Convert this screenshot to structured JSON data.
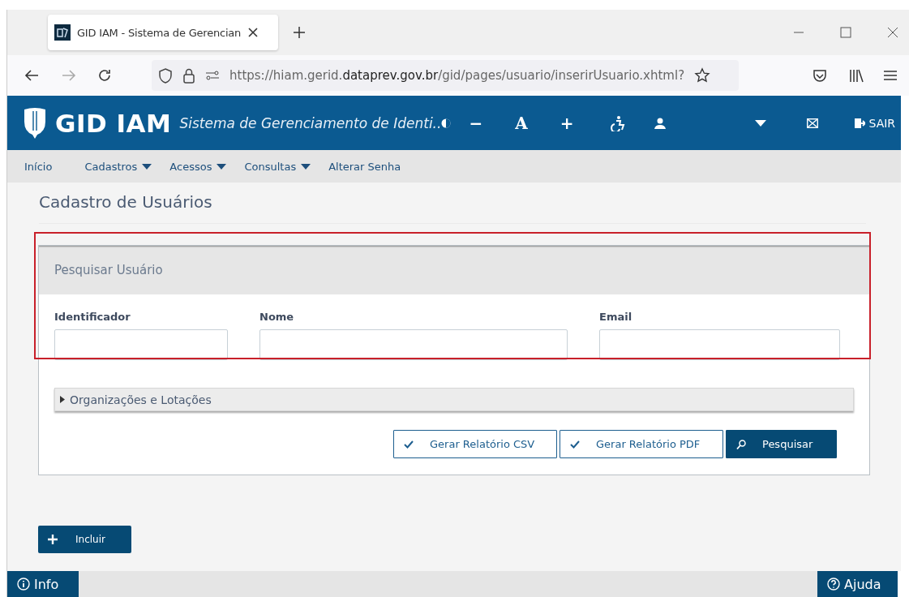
{
  "browser": {
    "tab_title": "GID IAM - Sistema de Gerencian",
    "url": {
      "scheme_host": "https://hiam.gerid.",
      "domain": "dataprev.gov.br",
      "path": "/gid/pages/usuario/inserirUsuario.xhtml?"
    }
  },
  "header": {
    "logo": "GID IAM",
    "subtitle": "Sistema de Gerenciamento de Identi..",
    "tools": [
      "−",
      "A",
      "+"
    ],
    "logout": "SAIR"
  },
  "menu": [
    {
      "label": "Início",
      "dropdown": false
    },
    {
      "label": "Cadastros",
      "dropdown": true
    },
    {
      "label": "Acessos",
      "dropdown": true
    },
    {
      "label": "Consultas",
      "dropdown": true
    },
    {
      "label": "Alterar Senha",
      "dropdown": false
    }
  ],
  "page_title": "Cadastro de Usuários",
  "search_panel": {
    "title": "Pesquisar Usuário",
    "highlighted": true,
    "fields": [
      {
        "label": "Identificador"
      },
      {
        "label": "Nome"
      },
      {
        "label": "Email"
      }
    ]
  },
  "accordion": {
    "label": "Organizações e Lotações",
    "expanded": false
  },
  "actions": [
    {
      "label": "Gerar Relatório CSV",
      "kind": "outline"
    },
    {
      "label": "Gerar Relatório PDF",
      "kind": "outline"
    },
    {
      "label": "Pesquisar",
      "kind": "primary"
    }
  ],
  "add_button": "Incluir",
  "footer": {
    "info": "Info",
    "help": "Ajuda"
  }
}
